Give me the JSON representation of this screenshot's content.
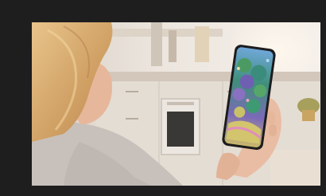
{
  "viewer": {
    "background_color": "#1e1e1f"
  },
  "photo": {
    "subject": "woman-holding-smartphone-in-kitchen",
    "phone_screen_content": "painted-landscape-artwork",
    "colors": {
      "kitchen_wall": "#e9e1d8",
      "cabinet": "#e4ddd4",
      "hair": "#d7ad6f",
      "skin": "#e7b79b",
      "sweater": "#c8c1bb",
      "phone_body": "#1c1c1e"
    }
  }
}
